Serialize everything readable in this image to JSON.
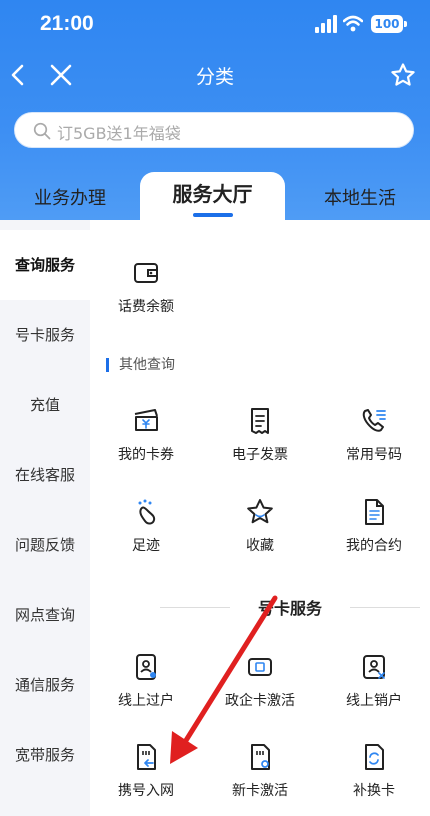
{
  "status_bar": {
    "time": "21:00",
    "battery": "100"
  },
  "nav": {
    "title": "分类"
  },
  "search": {
    "placeholder": "订5GB送1年福袋"
  },
  "top_tabs": [
    {
      "label": "业务办理"
    },
    {
      "label": "服务大厅"
    },
    {
      "label": "本地生活"
    }
  ],
  "sidebar": {
    "items": [
      {
        "label": "查询服务"
      },
      {
        "label": "号卡服务"
      },
      {
        "label": "充值"
      },
      {
        "label": "在线客服"
      },
      {
        "label": "问题反馈"
      },
      {
        "label": "网点查询"
      },
      {
        "label": "通信服务"
      },
      {
        "label": "宽带服务"
      }
    ]
  },
  "content": {
    "top_item": {
      "label": "话费余额",
      "icon": "wallet-icon"
    },
    "other_section": {
      "title": "其他查询",
      "items": [
        {
          "label": "我的卡券",
          "icon": "coupon-icon"
        },
        {
          "label": "电子发票",
          "icon": "invoice-icon"
        },
        {
          "label": "常用号码",
          "icon": "phone-list-icon"
        },
        {
          "label": "足迹",
          "icon": "footprint-icon"
        },
        {
          "label": "收藏",
          "icon": "star-icon"
        },
        {
          "label": "我的合约",
          "icon": "contract-icon"
        }
      ]
    },
    "card_section": {
      "title": "号卡服务",
      "items": [
        {
          "label": "线上过户",
          "icon": "transfer-id-icon"
        },
        {
          "label": "政企卡激活",
          "icon": "sim-activate-icon"
        },
        {
          "label": "线上销户",
          "icon": "cancel-account-icon"
        },
        {
          "label": "携号入网",
          "icon": "port-in-icon"
        },
        {
          "label": "新卡激活",
          "icon": "new-sim-icon"
        },
        {
          "label": "补换卡",
          "icon": "replace-sim-icon"
        }
      ]
    }
  },
  "colors": {
    "brand_blue": "#2f86f1",
    "accent": "#1c6fe8",
    "arrow_red": "#e02020",
    "sidebar_bg": "#f4f5f9"
  }
}
